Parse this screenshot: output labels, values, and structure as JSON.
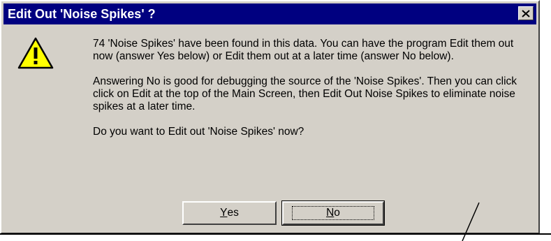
{
  "window": {
    "title": "Edit Out 'Noise Spikes' ?"
  },
  "icons": {
    "close": "close-icon",
    "warning": "warning-icon"
  },
  "message": {
    "paragraph1": " 74 'Noise Spikes' have been found in this data.  You can have the program Edit them out now (answer Yes below) or Edit them out at a later time (answer No below).",
    "paragraph2": "Answering No is good for debugging the source of the 'Noise Spikes'.  Then you can click click on Edit at the top of the Main Screen, then Edit Out Noise Spikes to eliminate noise spikes at a later time.",
    "question": "Do you want to Edit out 'Noise Spikes' now?"
  },
  "buttons": {
    "yes": {
      "mnemonic": "Y",
      "rest": "es"
    },
    "no": {
      "mnemonic": "N",
      "rest": "o"
    }
  },
  "colors": {
    "titlebar": "#000080",
    "face": "#d4d0c8",
    "warning_fill": "#ffff00"
  }
}
